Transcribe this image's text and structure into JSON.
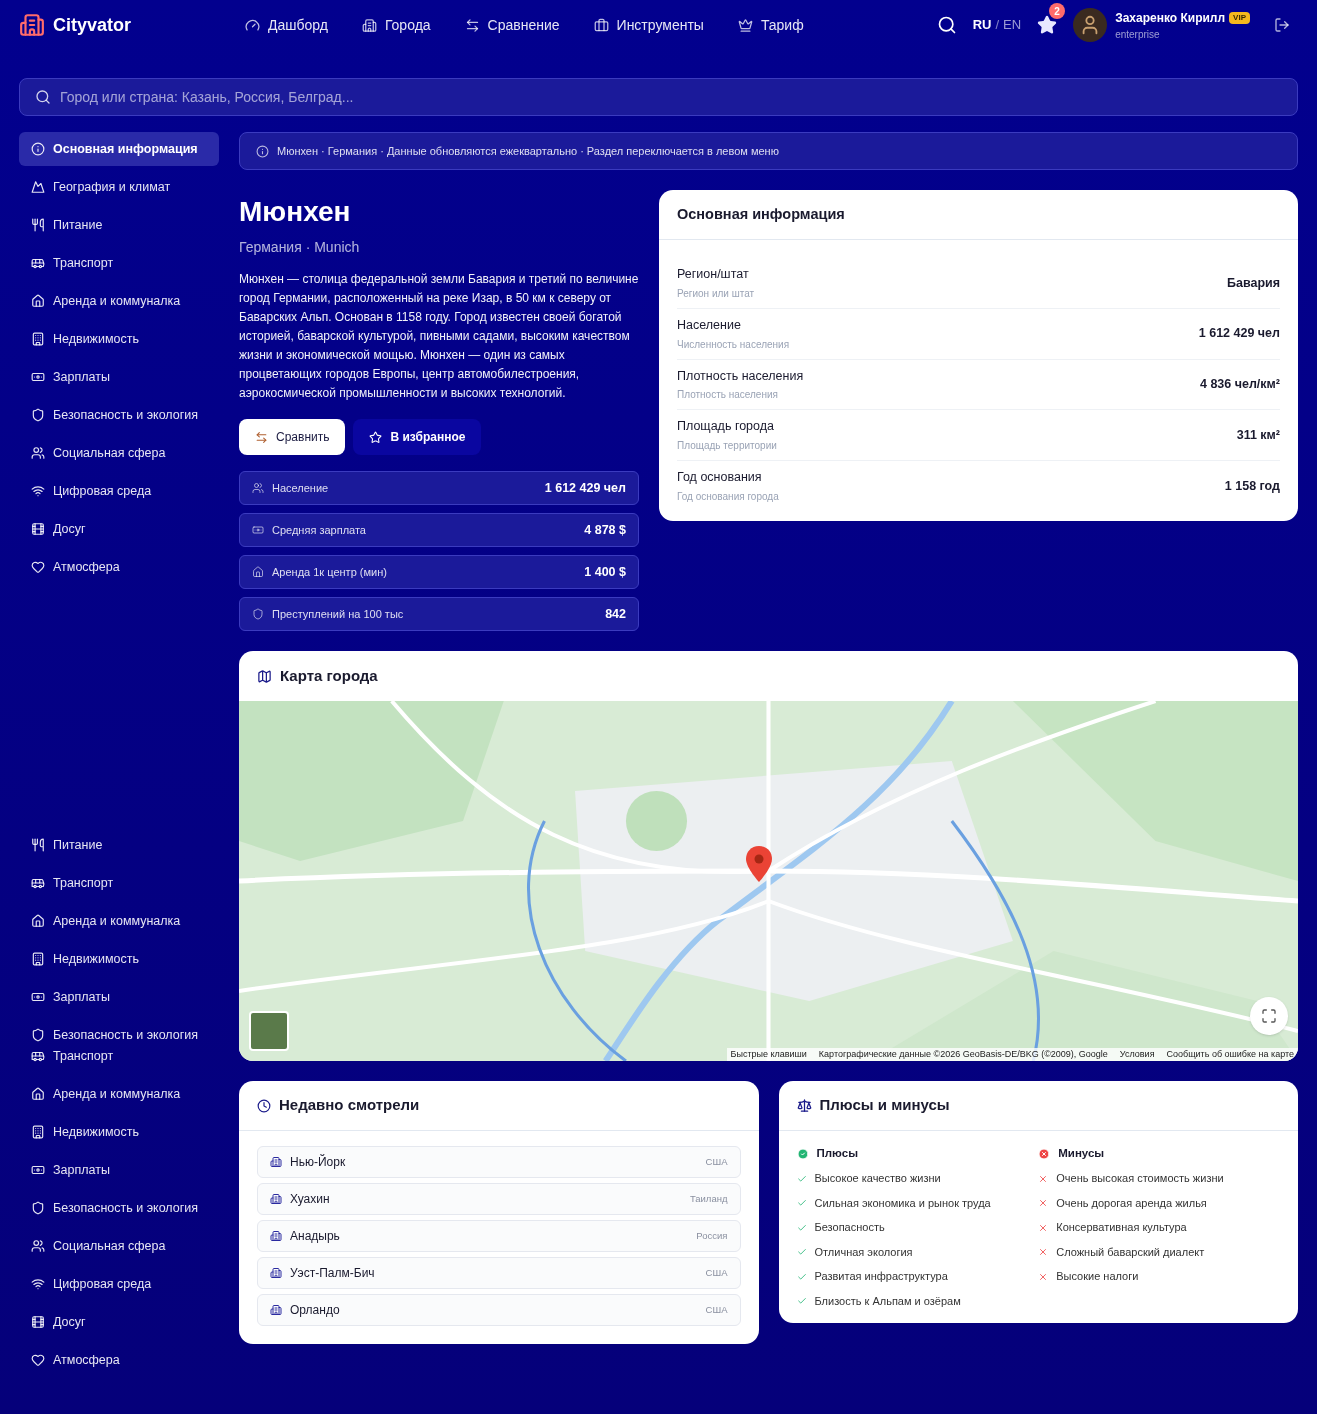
{
  "header": {
    "logo": "Cityvator",
    "nav": [
      {
        "label": "Дашборд",
        "kind": "dashboard"
      },
      {
        "label": "Города",
        "kind": "cities"
      },
      {
        "label": "Сравнение",
        "kind": "compare"
      },
      {
        "label": "Инструменты",
        "kind": "tools"
      },
      {
        "label": "Тариф",
        "kind": "plan"
      }
    ],
    "languages": [
      {
        "label": "RU",
        "selected": true
      },
      {
        "label": "EN",
        "selected": false
      }
    ],
    "language_separator": "/",
    "favorites_count": "2",
    "user": {
      "name": "Захаренко Кирилл",
      "badge": "VIP",
      "plan": "enterprise"
    }
  },
  "search": {
    "placeholder": "Город или страна: Казань, Россия, Белград..."
  },
  "sidebar": {
    "items": [
      {
        "label": "Основная информация",
        "kind": "info",
        "selected": true
      },
      {
        "label": "География и климат",
        "kind": "geo",
        "selected": false
      },
      {
        "label": "Питание",
        "kind": "food",
        "selected": false
      },
      {
        "label": "Транспорт",
        "kind": "transport",
        "selected": false
      },
      {
        "label": "Аренда и коммуналка",
        "kind": "rent",
        "selected": false
      },
      {
        "label": "Недвижимость",
        "kind": "realty",
        "selected": false
      },
      {
        "label": "Зарплаты",
        "kind": "salary",
        "selected": false
      },
      {
        "label": "Безопасность и экология",
        "kind": "safety",
        "selected": false
      },
      {
        "label": "Социальная сфера",
        "kind": "social",
        "selected": false
      },
      {
        "label": "Цифровая среда",
        "kind": "digital",
        "selected": false
      },
      {
        "label": "Досуг",
        "kind": "leisure",
        "selected": false
      },
      {
        "label": "Атмосфера",
        "kind": "mood",
        "selected": false
      }
    ],
    "lower_items": [
      {
        "label": "Питание",
        "kind": "food"
      },
      {
        "label": "Транспорт",
        "kind": "transport"
      },
      {
        "label": "Аренда и коммуналка",
        "kind": "rent"
      },
      {
        "label": "Недвижимость",
        "kind": "realty"
      },
      {
        "label": "Зарплаты",
        "kind": "salary"
      },
      {
        "label": "Безопасность и экология",
        "kind": "safety"
      }
    ],
    "lower_items_2": [
      {
        "label": "Транспорт",
        "kind": "transport"
      },
      {
        "label": "Аренда и коммуналка",
        "kind": "rent"
      },
      {
        "label": "Недвижимость",
        "kind": "realty"
      },
      {
        "label": "Зарплаты",
        "kind": "salary"
      },
      {
        "label": "Безопасность и экология",
        "kind": "safety"
      },
      {
        "label": "Социальная сфера",
        "kind": "social"
      },
      {
        "label": "Цифровая среда",
        "kind": "digital"
      },
      {
        "label": "Досуг",
        "kind": "leisure"
      },
      {
        "label": "Атмосфера",
        "kind": "mood"
      }
    ]
  },
  "notice": "Мюнхен · Германия · Данные обновляются ежеквартально · Раздел переключается в левом меню",
  "city": {
    "name": "Мюнхен",
    "subtitle": "Германия · Munich",
    "description": "Мюнхен — столица федеральной земли Бавария и третий по величине город Германии, расположенный на реке Изар, в 50 км к северу от Баварских Альп. Основан в 1158 году. Город известен своей богатой историей, баварской культурой, пивными садами, высоким качеством жизни и экономической мощью. Мюнхен — один из самых процветающих городов Европы, центр автомобилестроения, аэрокосмической промышленности и высоких технологий.",
    "buttons": [
      {
        "label": "Сравнить",
        "kind": "compare"
      },
      {
        "label": "В избранное",
        "kind": "favorite"
      }
    ]
  },
  "stats": [
    {
      "label": "Население",
      "value": "1 612 429 чел",
      "kind": "people"
    },
    {
      "label": "Средняя зарплата",
      "value": "4 878 $",
      "kind": "salary"
    },
    {
      "label": "Аренда 1к центр (мин)",
      "value": "1 400 $",
      "kind": "rent"
    },
    {
      "label": "Преступлений на 100 тыс",
      "value": "842",
      "kind": "safety"
    }
  ],
  "basic_info": {
    "title": "Основная информация",
    "rows": [
      {
        "label": "Регион/штат",
        "hint": "Регион или штат",
        "value": "Бавария"
      },
      {
        "label": "Население",
        "hint": "Численность населения",
        "value": "1 612 429 чел"
      },
      {
        "label": "Плотность населения",
        "hint": "Плотность населения",
        "value": "4 836 чел/км²"
      },
      {
        "label": "Площадь города",
        "hint": "Площадь территории",
        "value": "311 км²"
      },
      {
        "label": "Год основания",
        "hint": "Год основания города",
        "value": "1 158 год"
      }
    ]
  },
  "map": {
    "title": "Карта города",
    "attribution": [
      "Быстрые клавиши",
      "Картографические данные ©2026 GeoBasis-DE/BKG (©2009), Google",
      "Условия",
      "Сообщить об ошибке на карте"
    ]
  },
  "recent": {
    "title": "Недавно смотрели",
    "items": [
      {
        "city": "Нью-Йорк",
        "country": "США"
      },
      {
        "city": "Хуахин",
        "country": "Таиланд"
      },
      {
        "city": "Анадырь",
        "country": "Россия"
      },
      {
        "city": "Уэст-Палм-Бич",
        "country": "США"
      },
      {
        "city": "Орландо",
        "country": "США"
      }
    ]
  },
  "pros_cons": {
    "title": "Плюсы и минусы",
    "columns": [
      {
        "kind": "pros",
        "title": "Плюсы",
        "items": [
          "Высокое качество жизни",
          "Сильная экономика и рынок труда",
          "Безопасность",
          "Отличная экология",
          "Развитая инфраструктура",
          "Близость к Альпам и озёрам"
        ]
      },
      {
        "kind": "cons",
        "title": "Минусы",
        "items": [
          "Очень высокая стоимость жизни",
          "Очень дорогая аренда жилья",
          "Консервативная культура",
          "Сложный баварский диалект",
          "Высокие налоги"
        ]
      }
    ]
  }
}
